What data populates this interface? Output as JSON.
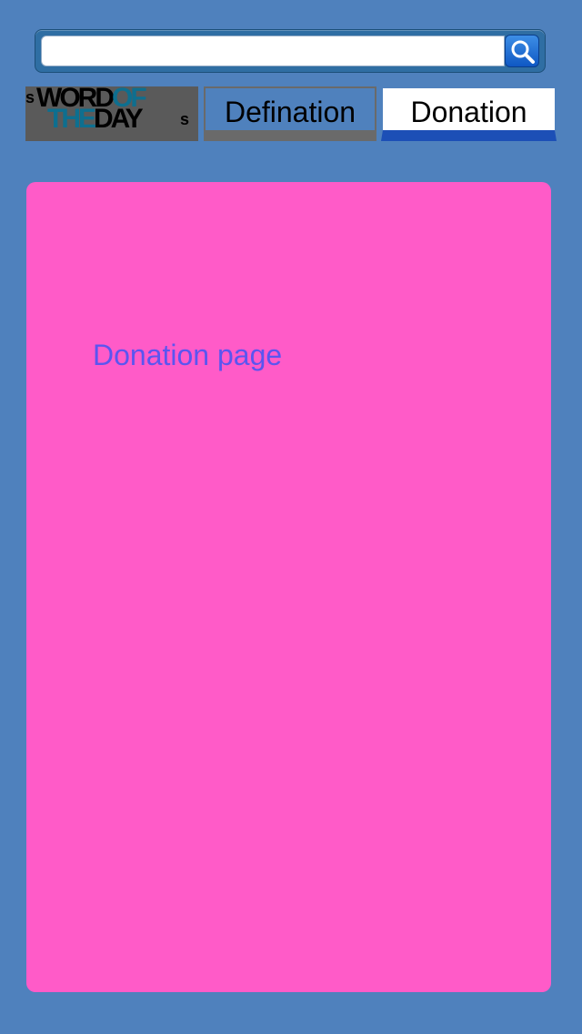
{
  "search": {
    "value": "",
    "placeholder": ""
  },
  "tabs": {
    "logo": {
      "line1_black": "WORD",
      "line1_teal": "OF",
      "line2_teal": "THE",
      "line2_black": "DAY",
      "side_left": "s",
      "side_right": "s"
    },
    "defination": {
      "label": "Defination"
    },
    "donation": {
      "label": "Donation",
      "active": true
    }
  },
  "content": {
    "text": "Donation page"
  },
  "colors": {
    "background": "#4f81bd",
    "panel": "#ff5bc8",
    "text_accent": "#5b55f0",
    "active_tab_indicator": "#1c4fb6"
  },
  "icons": {
    "search": "search-icon"
  }
}
